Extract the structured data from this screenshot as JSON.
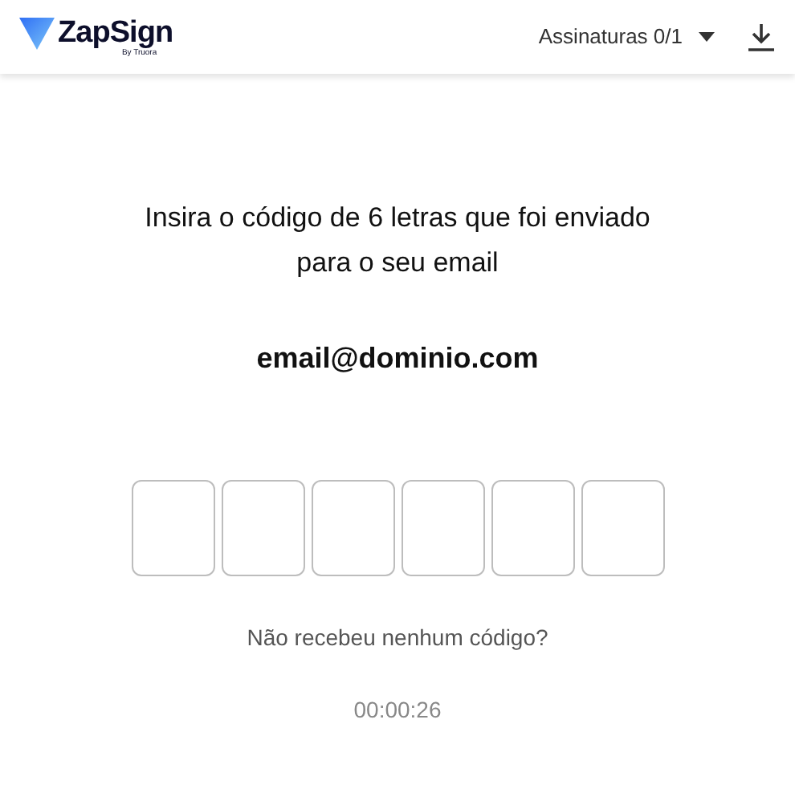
{
  "header": {
    "logo": {
      "name": "ZapSign",
      "byline": "By Truora"
    },
    "signatures_menu": "Assinaturas 0/1"
  },
  "prompt": "Insira o código de 6 letras que foi enviado para o seu email",
  "email": "email@dominio.com",
  "code_fields": [
    {
      "selected": false
    },
    {
      "selected": false
    },
    {
      "selected": false
    },
    {
      "selected": false
    },
    {
      "selected": false
    },
    {
      "selected": false
    }
  ],
  "resend_link": "Não recebeu nenhum código?",
  "timer": "00:00:26"
}
